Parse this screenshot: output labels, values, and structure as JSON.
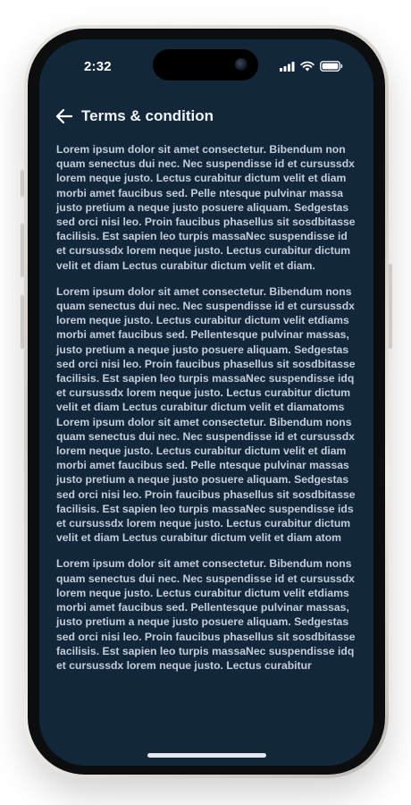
{
  "status_bar": {
    "time": "2:32",
    "icons": [
      "signal-icon",
      "wifi-icon",
      "battery-icon"
    ]
  },
  "header": {
    "back_icon": "arrow-left-icon",
    "title": "Terms & condition"
  },
  "paragraphs": [
    "Lorem ipsum dolor sit amet consectetur. Bibendum non quam senectus dui nec. Nec suspendisse id et cursussdx lorem neque justo. Lectus curabitur dictum velit et diam morbi amet faucibus sed. Pelle ntesque pulvinar massa justo pretium a neque justo posuere aliquam. Sedgestas sed orci nisi leo. Proin faucibus phasellus sit sosdbitasse facilisis. Est sapien leo turpis massaNec suspendisse id et cursussdx lorem neque justo. Lectus curabitur dictum velit et diam Lectus curabitur dictum velit et diam.",
    "Lorem ipsum dolor sit amet consectetur. Bibendum nons quam senectus dui nec. Nec suspendisse id et cursussdx lorem neque justo. Lectus curabitur dictum velit etdiams morbi amet faucibus sed. Pellentesque pulvinar massas, justo pretium a neque justo posuere aliquam. Sedgestas sed orci nisi leo. Proin faucibus phasellus sit sosdbitasse facilisis. Est sapien leo turpis massaNec suspendisse idq et cursussdx lorem neque justo. Lectus curabitur dictum velit et diam Lectus curabitur dictum velit et diamatoms Lorem ipsum dolor sit amet consectetur. Bibendum nons quam senectus dui nec. Nec suspendisse id et cursussdx lorem neque justo. Lectus curabitur dictum velit et diam morbi amet faucibus sed. Pelle ntesque pulvinar massas justo pretium a neque justo posuere aliquam. Sedgestas sed orci nisi leo. Proin faucibus phasellus sit sosdbitasse facilisis. Est sapien leo turpis massaNec suspendisse ids et cursussdx lorem neque justo. Lectus curabitur dictum velit et diam Lectus curabitur dictum velit et diam atom",
    "Lorem ipsum dolor sit amet consectetur. Bibendum nons quam senectus dui nec. Nec suspendisse id et cursussdx lorem neque justo. Lectus curabitur dictum velit etdiams morbi amet faucibus sed. Pellentesque pulvinar massas, justo pretium a neque justo posuere aliquam. Sedgestas sed orci nisi leo. Proin faucibus phasellus sit sosdbitasse facilisis. Est sapien leo turpis massaNec suspendisse idq et cursussdx lorem neque justo. Lectus curabitur"
  ],
  "colors": {
    "background": "#13273b",
    "text": "#c3ccd8",
    "title": "#f2f4f7"
  }
}
